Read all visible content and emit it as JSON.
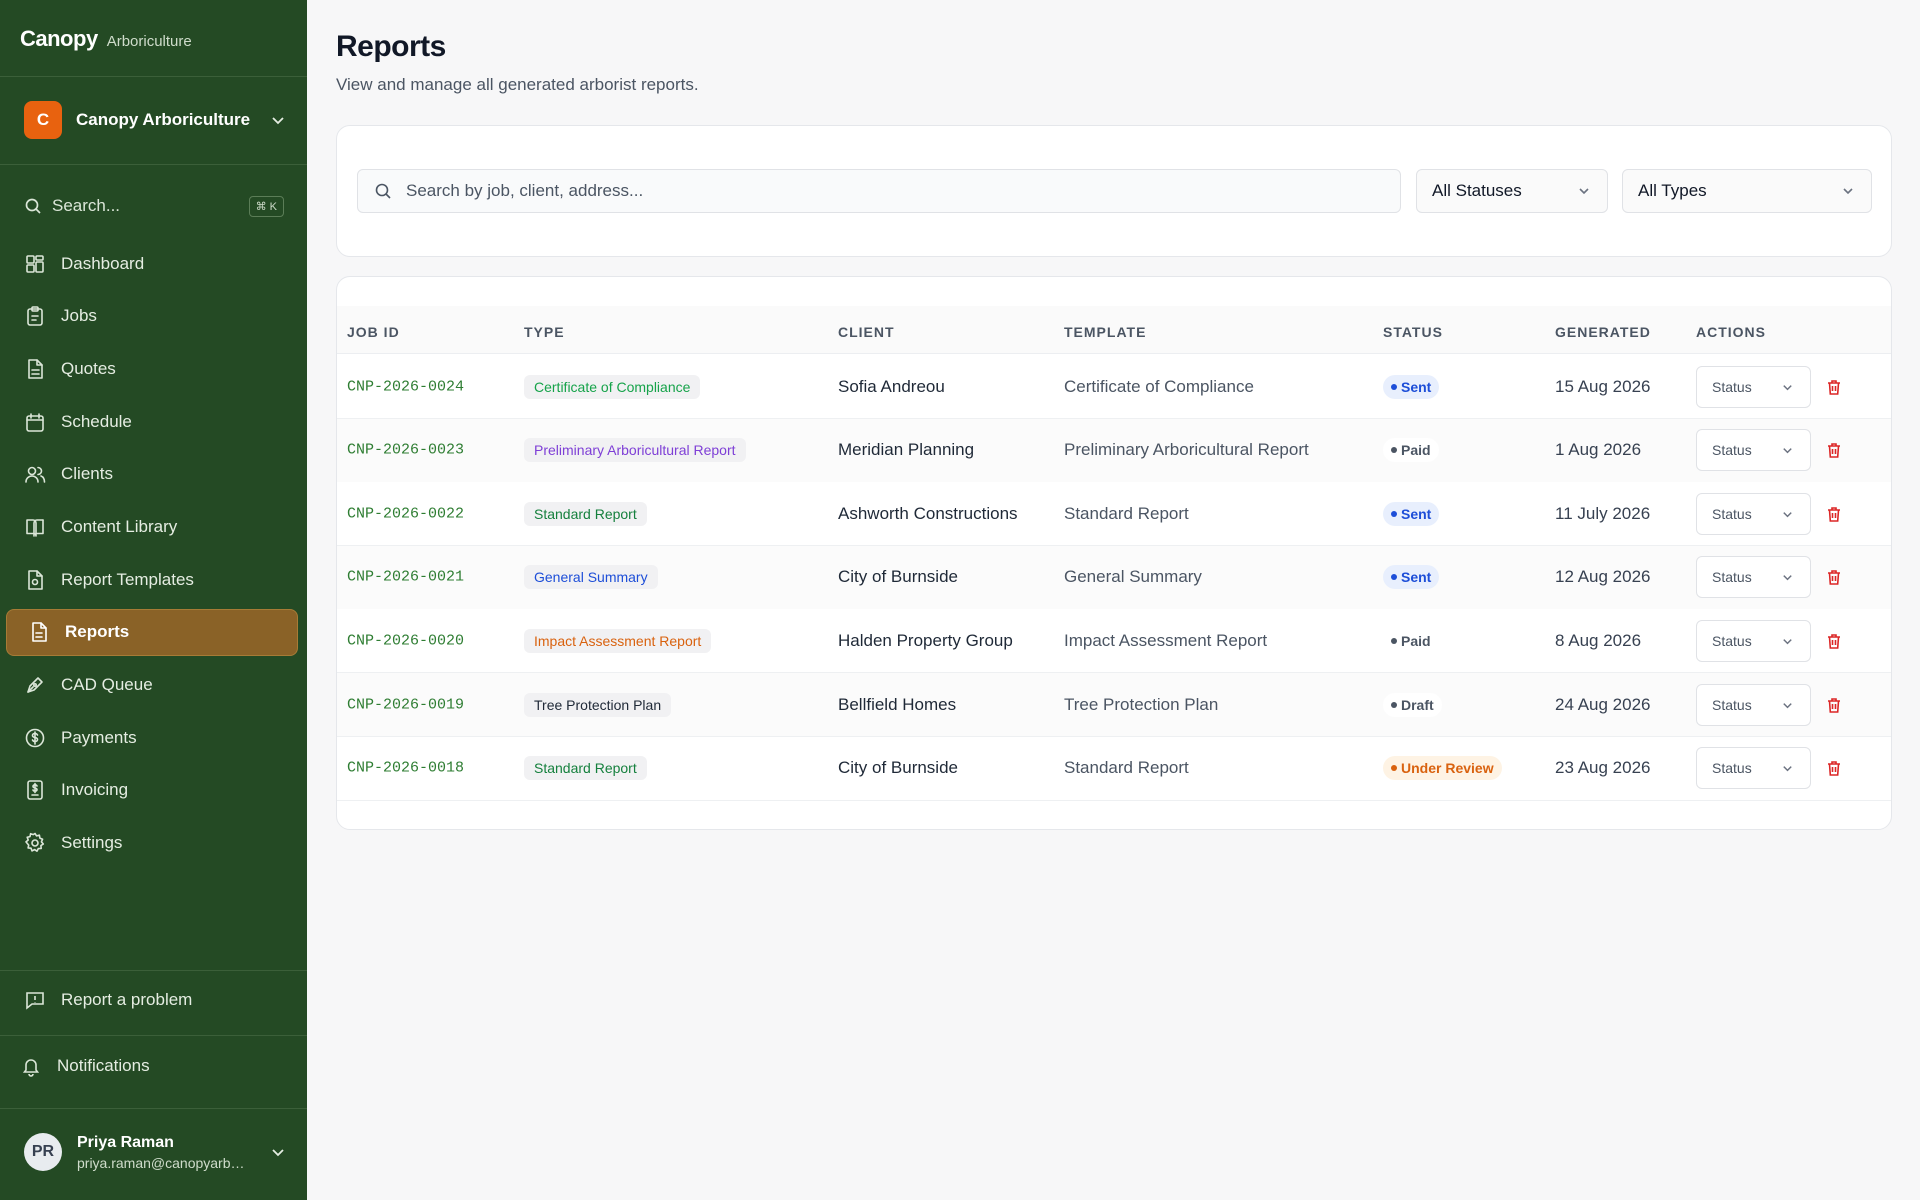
{
  "brand": {
    "name": "Canopy",
    "sub": "Arboriculture"
  },
  "org": {
    "initial": "C",
    "name": "Canopy Arboriculture"
  },
  "sidebar_search": {
    "label": "Search...",
    "shortcut": "⌘ K"
  },
  "nav": [
    {
      "label": "Dashboard",
      "icon": "dashboard-icon"
    },
    {
      "label": "Jobs",
      "icon": "clipboard-icon"
    },
    {
      "label": "Quotes",
      "icon": "document-icon"
    },
    {
      "label": "Schedule",
      "icon": "calendar-icon"
    },
    {
      "label": "Clients",
      "icon": "users-icon"
    },
    {
      "label": "Content Library",
      "icon": "book-icon"
    },
    {
      "label": "Report Templates",
      "icon": "template-icon"
    },
    {
      "label": "Reports",
      "icon": "report-icon",
      "active": true
    },
    {
      "label": "CAD Queue",
      "icon": "pen-tool-icon"
    },
    {
      "label": "Payments",
      "icon": "dollar-circle-icon"
    },
    {
      "label": "Invoicing",
      "icon": "invoice-icon"
    },
    {
      "label": "Settings",
      "icon": "gear-icon"
    }
  ],
  "footer": {
    "report_problem": "Report a problem",
    "notifications": "Notifications"
  },
  "user": {
    "initials": "PR",
    "name": "Priya Raman",
    "email": "priya.raman@canopyarboriculture.com"
  },
  "page": {
    "title": "Reports",
    "subtitle": "View and manage all generated arborist reports."
  },
  "filters": {
    "search_placeholder": "Search by job, client, address...",
    "status_value": "All Statuses",
    "type_value": "All Types"
  },
  "table": {
    "headers": [
      "JOB ID",
      "TYPE",
      "CLIENT",
      "TEMPLATE",
      "STATUS",
      "GENERATED",
      "ACTIONS"
    ],
    "action_label": "Status",
    "rows": [
      {
        "id": "CNP-2026-0024",
        "type": "Certificate of Compliance",
        "type_color": "#16a34a",
        "client": "Sofia Andreou",
        "template": "Certificate of Compliance",
        "status": "Sent",
        "generated": "15 Aug 2026"
      },
      {
        "id": "CNP-2026-0023",
        "type": "Preliminary Arboricultural Report",
        "type_color": "#7e3fd6",
        "client": "Meridian Planning",
        "template": "Preliminary Arboricultural Report",
        "status": "Paid",
        "generated": "1 Aug 2026"
      },
      {
        "id": "CNP-2026-0022",
        "type": "Standard Report",
        "type_color": "#15803d",
        "client": "Ashworth Constructions",
        "template": "Standard Report",
        "status": "Sent",
        "generated": "11 July 2026"
      },
      {
        "id": "CNP-2026-0021",
        "type": "General Summary",
        "type_color": "#1d4ed8",
        "client": "City of Burnside",
        "template": "General Summary",
        "status": "Sent",
        "generated": "12 Aug 2026"
      },
      {
        "id": "CNP-2026-0020",
        "type": "Impact Assessment Report",
        "type_color": "#d9620f",
        "client": "Halden Property Group",
        "template": "Impact Assessment Report",
        "status": "Paid",
        "generated": "8 Aug 2026"
      },
      {
        "id": "CNP-2026-0019",
        "type": "Tree Protection Plan",
        "type_color": "#1f2937",
        "client": "Bellfield Homes",
        "template": "Tree Protection Plan",
        "status": "Draft",
        "generated": "24 Aug 2026"
      },
      {
        "id": "CNP-2026-0018",
        "type": "Standard Report",
        "type_color": "#15803d",
        "client": "City of Burnside",
        "template": "Standard Report",
        "status": "Under Review",
        "generated": "23 Aug 2026"
      }
    ]
  },
  "status_colors": {
    "Sent": {
      "fg": "#1d4ed8",
      "bg": "#e8effd"
    },
    "Paid": {
      "fg": "#4b5563",
      "bg": "#ffffff"
    },
    "Draft": {
      "fg": "#4b5563",
      "bg": "#ffffff"
    },
    "Under Review": {
      "fg": "#d9620f",
      "bg": "#fef3e4"
    }
  },
  "colors": {
    "sidebar": "#244a24",
    "active_nav": "#8a6227",
    "job_id": "#2e7d32",
    "delete": "#dc2626"
  }
}
